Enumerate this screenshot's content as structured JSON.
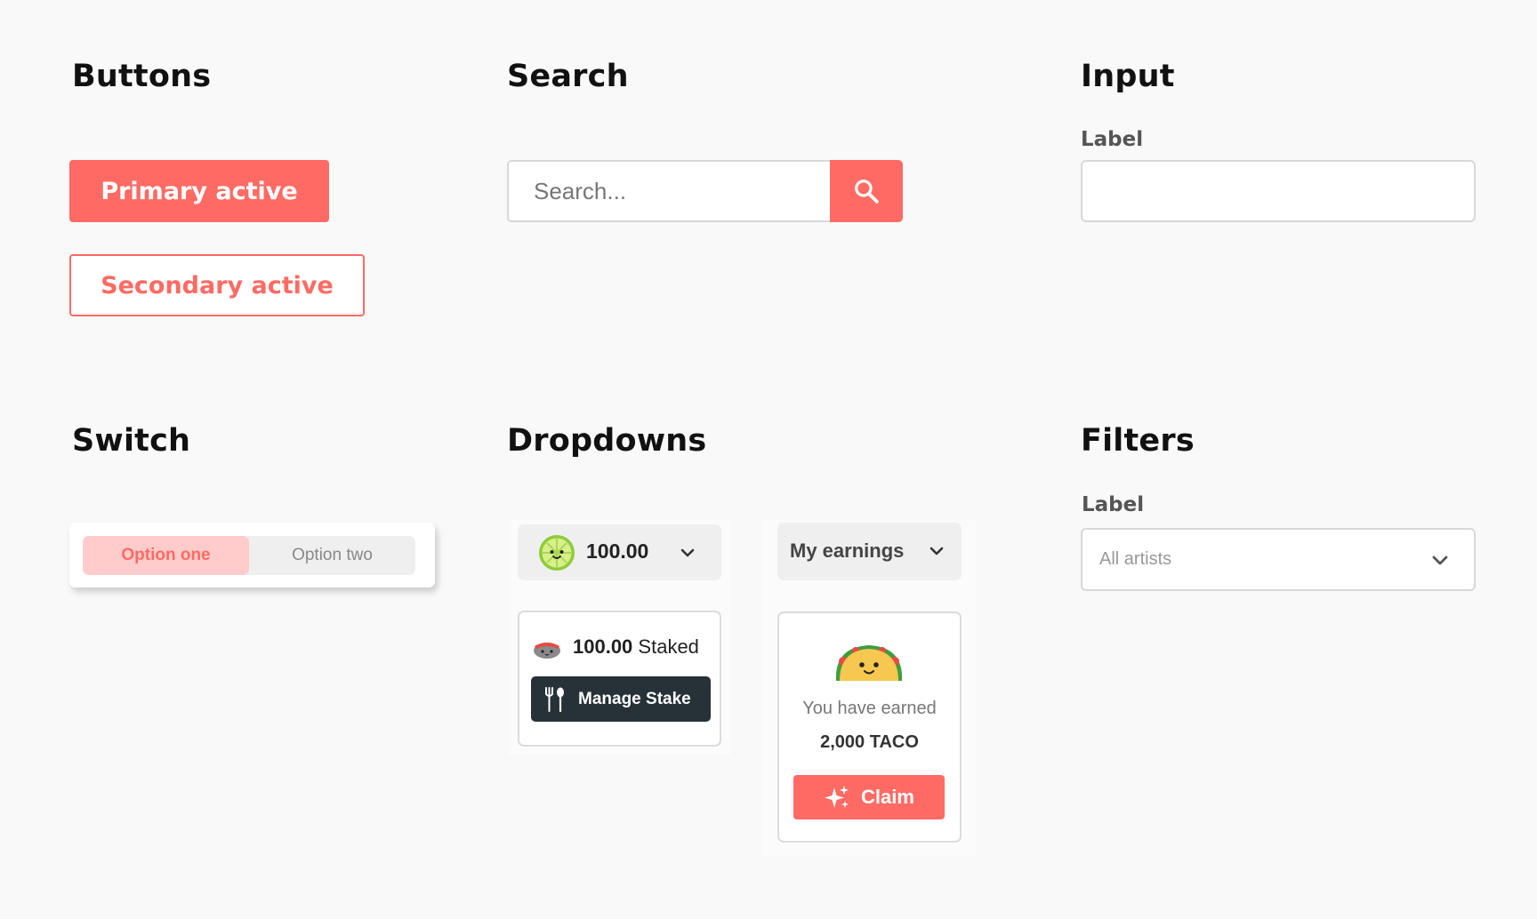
{
  "sections": {
    "buttons": "Buttons",
    "search": "Search",
    "input": "Input",
    "switch": "Switch",
    "dropdowns": "Dropdowns",
    "filters": "Filters"
  },
  "buttons": {
    "primary": "Primary active",
    "secondary": "Secondary active"
  },
  "search": {
    "placeholder": "Search..."
  },
  "input": {
    "label": "Label",
    "value": ""
  },
  "switch": {
    "option_one": "Option one",
    "option_two": "Option two",
    "selected": "Option one"
  },
  "dropdowns": {
    "balance": "100.00",
    "stake_amount": "100.00",
    "stake_suffix": "Staked",
    "manage_label": "Manage Stake",
    "earnings_label": "My earnings",
    "earned_text": "You have earned",
    "earned_amount": "2,000 TACO",
    "claim_label": "Claim"
  },
  "filters": {
    "label": "Label",
    "selected": "All artists"
  },
  "colors": {
    "accent": "#ff6b64",
    "accent_light": "#ffcccb",
    "dark": "#263238",
    "background": "#f9f9f9"
  },
  "icons": [
    "search-icon",
    "lime-coin-icon",
    "chevron-down-icon",
    "sushi-icon",
    "fork-spoon-icon",
    "taco-icon",
    "sparkle-icon"
  ]
}
